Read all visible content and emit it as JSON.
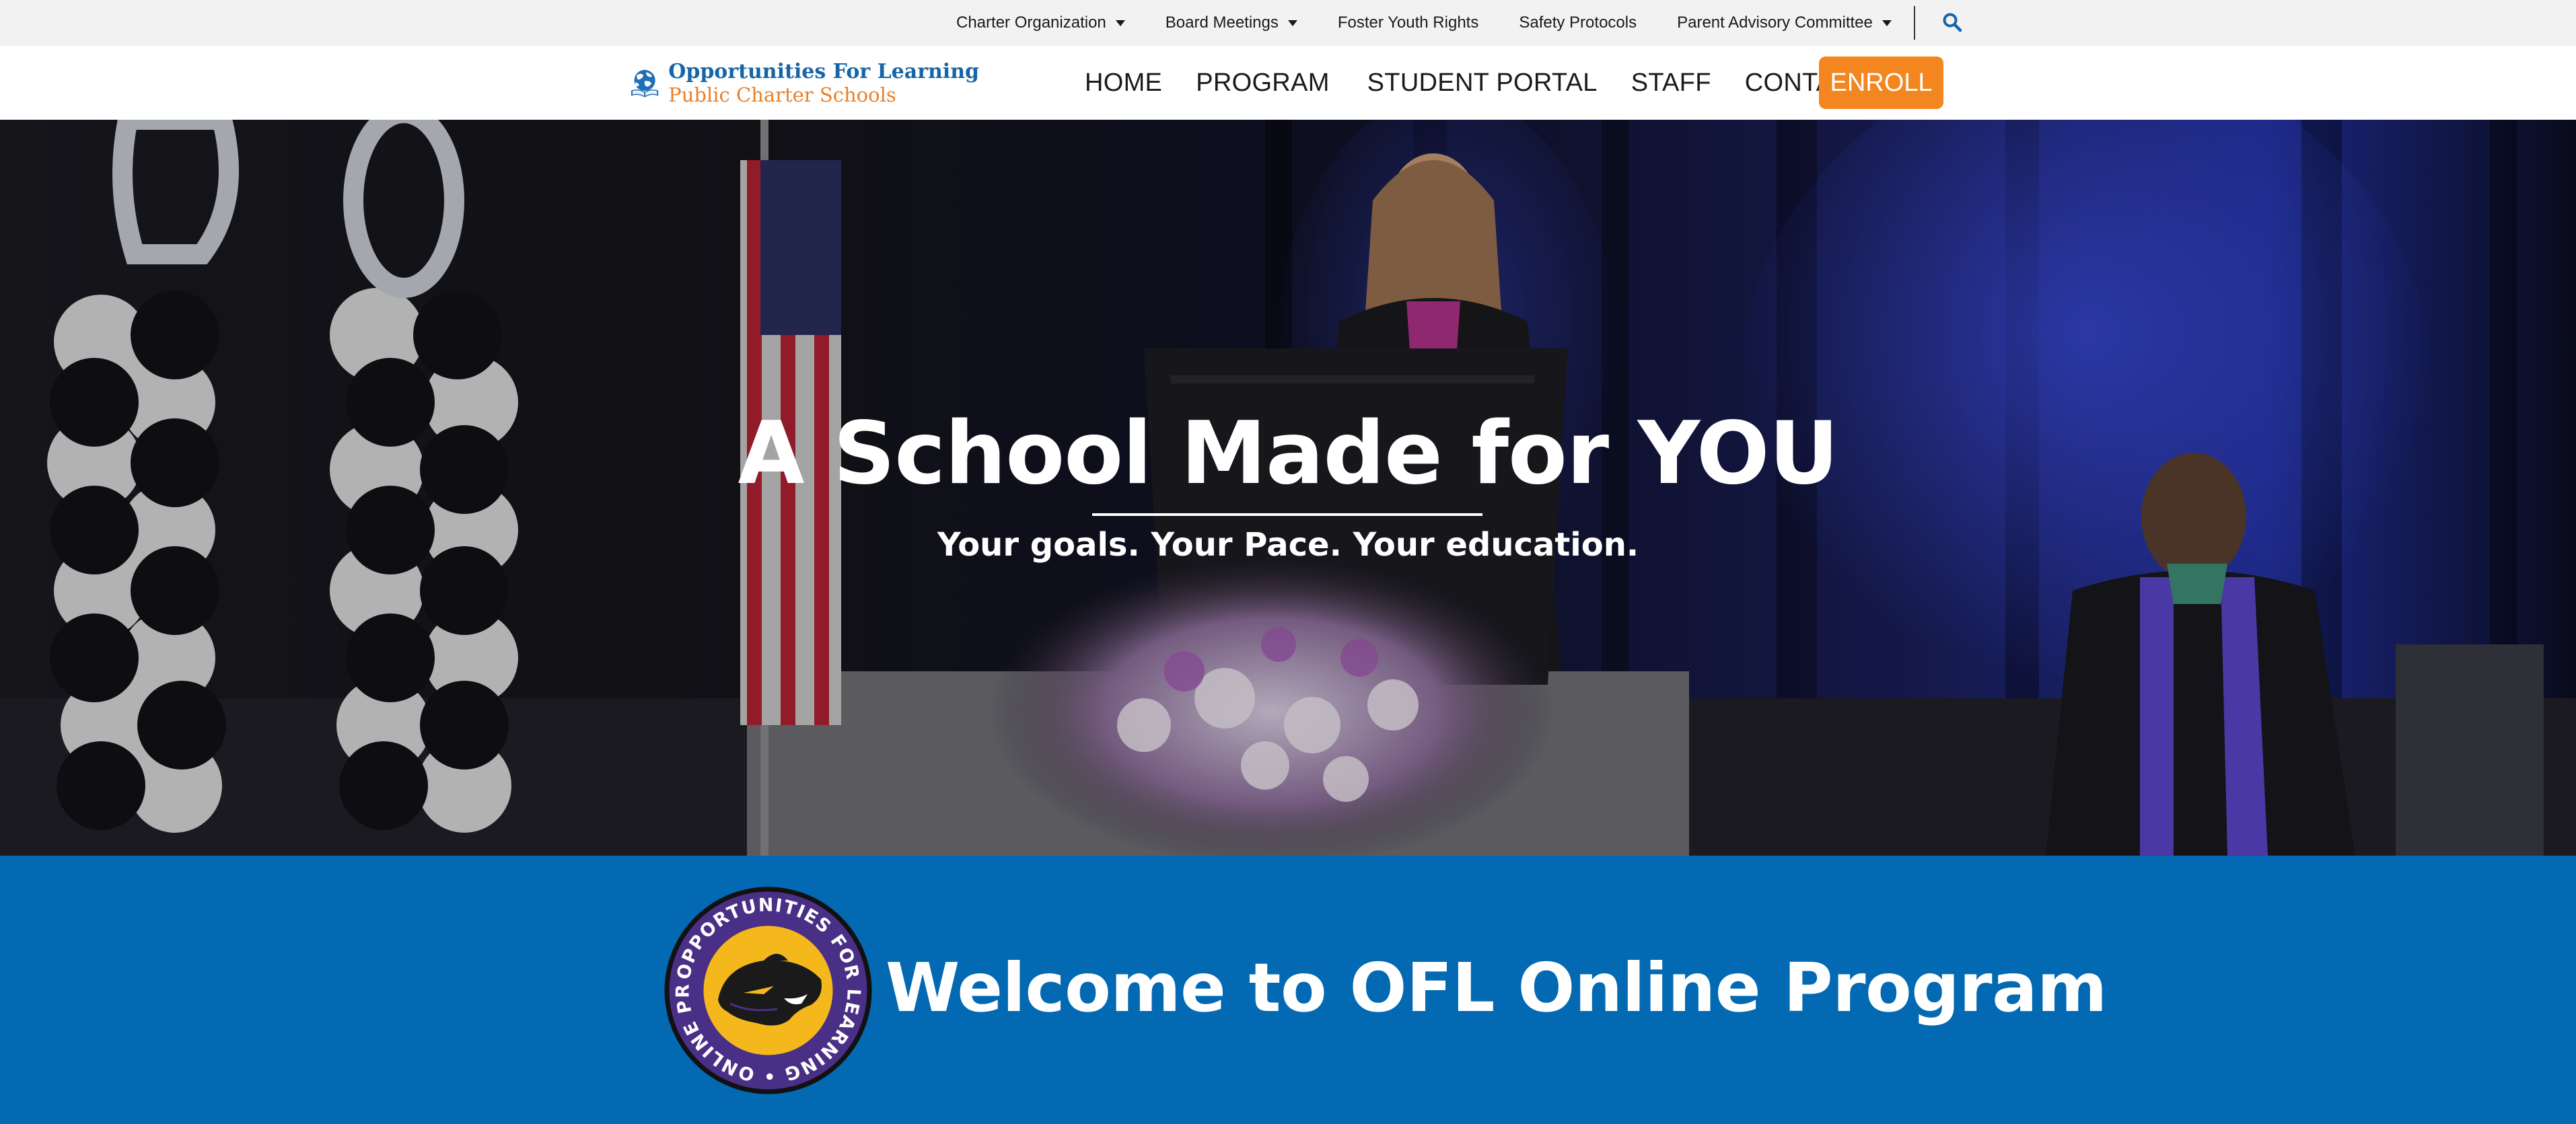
{
  "utility_nav": {
    "items": [
      {
        "label": "Charter Organization",
        "dropdown": true
      },
      {
        "label": "Board Meetings",
        "dropdown": true
      },
      {
        "label": "Foster Youth Rights",
        "dropdown": false
      },
      {
        "label": "Safety Protocols",
        "dropdown": false
      },
      {
        "label": "Parent Advisory Committee",
        "dropdown": true
      }
    ],
    "search_icon": "search-icon"
  },
  "header": {
    "logo_line1": "Opportunities For Learning",
    "logo_line2": "Public Charter Schools",
    "nav": [
      "HOME",
      "PROGRAM",
      "STUDENT PORTAL",
      "STAFF",
      "CONTACT"
    ],
    "enroll_label": "ENROLL"
  },
  "hero": {
    "title": "A School Made for YOU",
    "subtitle": "Your goals. Your Pace. Your education."
  },
  "welcome": {
    "title": "Welcome to OFL Online Program",
    "badge_text": "OPPORTUNITIES FOR LEARNING • ONLINE PROGRAM"
  },
  "colors": {
    "brand_blue": "#0369b2",
    "logo_blue": "#1565a8",
    "accent_orange": "#f4861f",
    "badge_purple": "#4a2f86",
    "badge_gold": "#f5b81c"
  }
}
